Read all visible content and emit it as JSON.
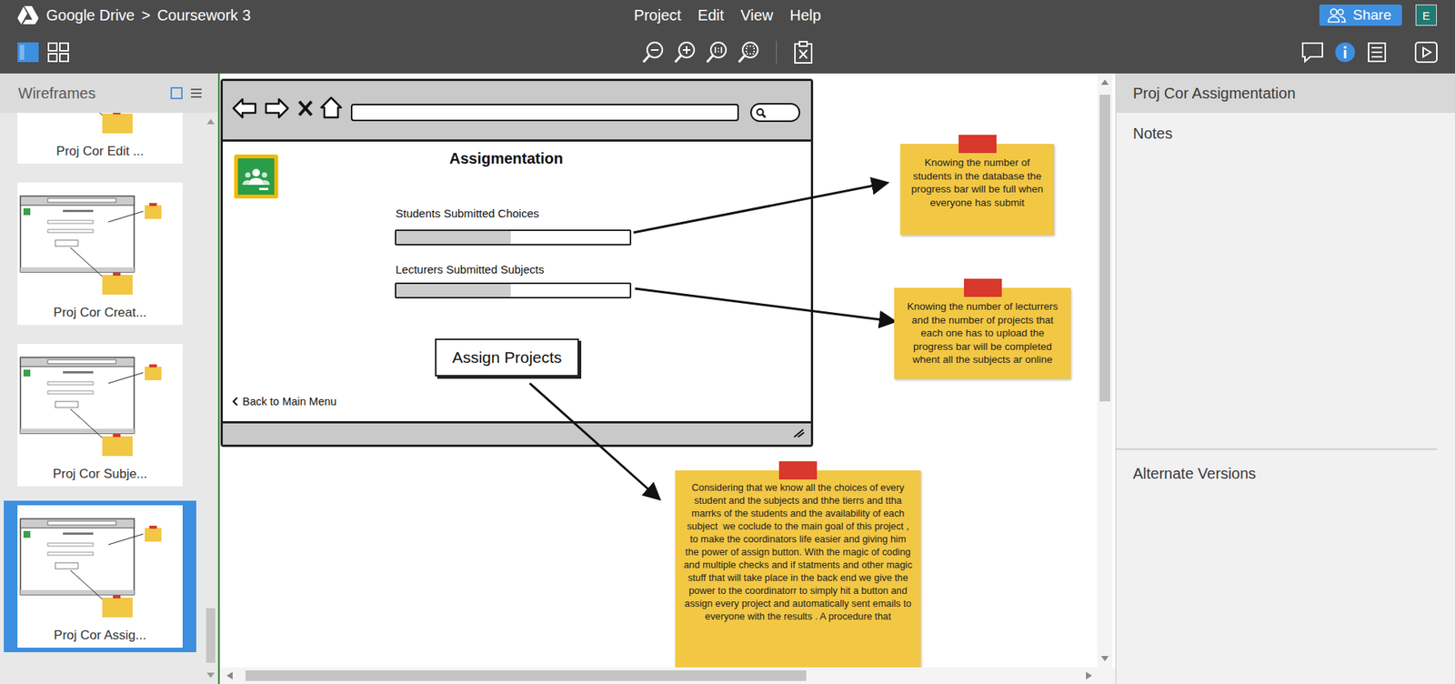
{
  "app": {
    "root": "Google Drive",
    "separator": ">",
    "project": "Coursework 3"
  },
  "menu": [
    "Project",
    "Edit",
    "View",
    "Help"
  ],
  "share": "Share",
  "avatar": "E",
  "sidebar": {
    "title": "Wireframes",
    "items": [
      {
        "label": "Proj Cor Edit ...",
        "selected": false
      },
      {
        "label": "Proj Cor Creat...",
        "selected": false
      },
      {
        "label": "Proj Cor Subje...",
        "selected": false
      },
      {
        "label": "Proj Cor Assig...",
        "selected": true
      }
    ]
  },
  "wireframe": {
    "title": "Assigmentation",
    "progress": [
      {
        "label": "Students Submitted Choices",
        "level": 0.49
      },
      {
        "label": "Lecturers Submitted Subjects",
        "level": 0.49
      }
    ],
    "button": "Assign Projects",
    "back": "Back to Main Menu"
  },
  "notes": [
    {
      "text": "Knowing the number of students in the database the progress bar will be full when everyone has submit"
    },
    {
      "text": "Knowing the number of lecturrers and the number of projects that each one has to upload the progress bar will be completed whent all the subjects ar online"
    },
    {
      "text": "Considering that we know all the choices of every student and the subjects and thhe tierrs and ttha marrks of the students and the availability of each subject  we coclude to the main goal of this project , to make the coordinators life easier and giving him the power of assign button. With the magic of coding and multiple checks and if statments and other magic stuff that will take place in the back end we give the power to the coordinatorr to simply hit a button and assign every project and automatically sent emails to everyone with the results . A procedure that"
    }
  ],
  "inspector": {
    "title": "Proj Cor Assigmentation",
    "notes_label": "Notes",
    "alternates_label": "Alternate Versions"
  }
}
